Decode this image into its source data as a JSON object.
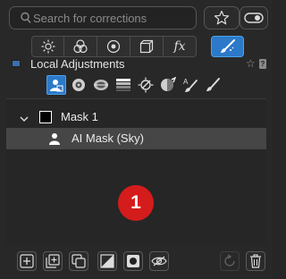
{
  "search": {
    "placeholder": "Search for corrections"
  },
  "tool_tabs": [
    {
      "name": "exposure-tab",
      "icon": "sun-icon"
    },
    {
      "name": "color-tab",
      "icon": "color-circles-icon"
    },
    {
      "name": "detail-tab",
      "icon": "lens-icon"
    },
    {
      "name": "geometry-tab",
      "icon": "cube-icon"
    },
    {
      "name": "effects-tab",
      "label": "fx"
    },
    {
      "name": "local-adjustments-tab",
      "icon": "brush-icon",
      "active": true
    }
  ],
  "section": {
    "title": "Local Adjustments"
  },
  "adjustment_modes": [
    "ai-mask-icon",
    "control-point-icon",
    "radial-icon",
    "gradient-icon",
    "auto-mask-icon",
    "eraser-icon",
    "text-brush-icon",
    "brush-icon"
  ],
  "masks": [
    {
      "label": "Mask 1",
      "expanded": true
    },
    {
      "label": "AI Mask (Sky)",
      "selected": true
    }
  ],
  "badge": {
    "number": "1"
  },
  "colors": {
    "accent": "#2c79c9",
    "badge": "#d51c1c",
    "selected_row": "#464646"
  }
}
